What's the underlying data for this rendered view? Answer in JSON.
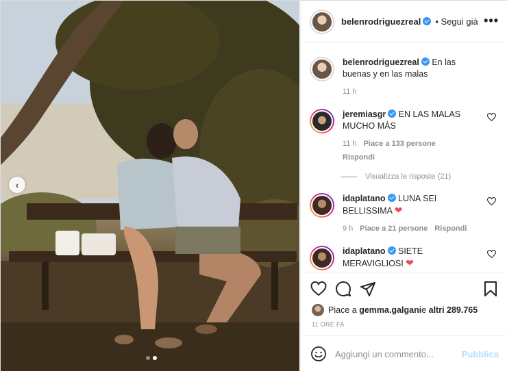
{
  "header": {
    "username": "belenrodriguezreal",
    "follow_status": "• Segui già",
    "more_label": "•••"
  },
  "caption": {
    "username": "belenrodriguezreal",
    "text": "En las buenas y en las malas",
    "time": "11 h"
  },
  "comments": [
    {
      "username": "jeremiasgr",
      "text": "EN LAS MALAS MUCHO MÁS",
      "time": "11 h",
      "likes": "Piace a 133 persone",
      "reply": "Rispondi",
      "view_replies": "Visualizza le risposte (21)"
    },
    {
      "username": "idaplatano",
      "text": "LUNA SEI BELLISSIMA",
      "emoji": "❤",
      "time": "9 h",
      "likes": "Piace a 21 persone",
      "reply": "Rispondi"
    },
    {
      "username": "idaplatano",
      "text": "SIETE MERAVIGLIOSI",
      "emoji": "❤"
    }
  ],
  "likes": {
    "prefix": "Piace a ",
    "user": "gemma.galgani",
    "middle": " e ",
    "others": "altri 289.765"
  },
  "time_ago": "11 ORE FA",
  "add_comment": {
    "placeholder": "Aggiungi un commento...",
    "publish_label": "Pubblica"
  },
  "carousel": {
    "prev_label": "‹",
    "dots": 2,
    "active_dot": 1
  },
  "colors": {
    "link_blue": "#3897f0",
    "heart_red": "#ed4956",
    "publish_disabled": "#b2dffc",
    "meta_gray": "#8e8e8e"
  }
}
